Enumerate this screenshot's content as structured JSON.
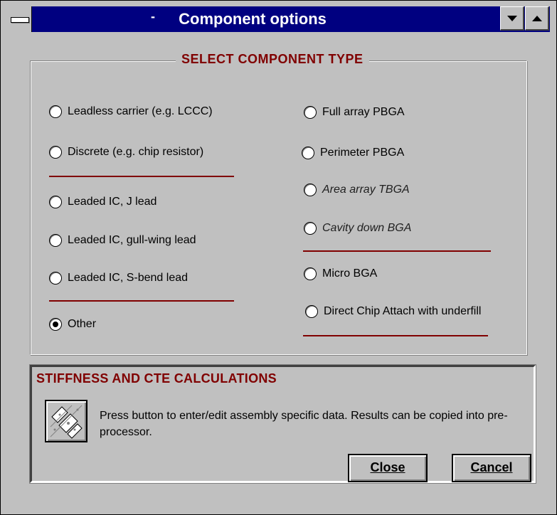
{
  "window": {
    "title": "Component options",
    "title_prefix": "-"
  },
  "group": {
    "title": "SELECT COMPONENT TYPE",
    "left_options": [
      {
        "label": "Leadless carrier (e.g. LCCC)",
        "selected": false
      },
      {
        "label": "Discrete (e.g. chip resistor)",
        "selected": false
      },
      {
        "label": "Leaded IC, J lead",
        "selected": false
      },
      {
        "label": "Leaded IC, gull-wing lead",
        "selected": false
      },
      {
        "label": "Leaded IC, S-bend lead",
        "selected": false
      },
      {
        "label": "Other",
        "selected": true
      }
    ],
    "right_options": [
      {
        "label": "Full array PBGA",
        "selected": false
      },
      {
        "label": "Perimeter PBGA",
        "selected": false
      },
      {
        "label": "Area array TBGA",
        "selected": false,
        "italic": true
      },
      {
        "label": "Cavity down BGA",
        "selected": false,
        "italic": true
      },
      {
        "label": "Micro BGA",
        "selected": false
      },
      {
        "label": "Direct Chip Attach with underfill",
        "selected": false
      }
    ]
  },
  "panel": {
    "title": "STIFFNESS AND CTE CALCULATIONS",
    "description": "Press button to enter/edit assembly specific data. Results can be copied into pre-processor."
  },
  "buttons": {
    "close": "Close",
    "cancel": "Cancel"
  },
  "colors": {
    "titlebar": "#000080",
    "accent": "#800000",
    "face": "#c0c0c0"
  }
}
